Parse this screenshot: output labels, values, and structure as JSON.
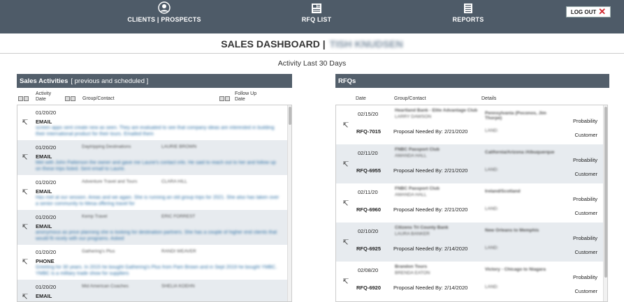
{
  "nav": {
    "clients_label": "CLIENTS | PROSPECTS",
    "rfq_label": "RFQ LIST",
    "reports_label": "REPORTS",
    "logout_label": "LOG OUT",
    "logout_icon": "x-icon"
  },
  "header": {
    "title": "SALES DASHBOARD |",
    "user_name": "TISH KNUDSEN"
  },
  "subtitle": "Activity Last 30 Days",
  "activities": {
    "title": "Sales Activities",
    "subtitle": "[ previous and scheduled ]",
    "col_activity_date": "Activity Date",
    "col_group": "Group/Contact",
    "col_followup": "Follow Up Date",
    "rows": [
      {
        "date": "01/20/20",
        "group": "",
        "contact": "",
        "type": "EMAIL",
        "note": "screen apps sent create new as seen. They are evaluated to see that company ideas are interested in building their international product for their tours. Emailed them"
      },
      {
        "date": "01/20/20",
        "group": "Daytripping Destinations",
        "contact": "LAURIE BROWN",
        "type": "EMAIL",
        "note": "Met with John Patterson the owner and gave me Laurie's contact info. He said to reach out to her and follow up on these trips listed. Sent email to Laurie."
      },
      {
        "date": "01/20/20",
        "group": "Adventure Travel and Tours",
        "contact": "CLARA HILL",
        "type": "EMAIL",
        "note": "Has met at our session. Areas and we again. She is running an old group trips for 2021. She also has taken over a senior community to Mesa offering travel for"
      },
      {
        "date": "01/20/20",
        "group": "Kemp Travel",
        "contact": "ERIC FORREST",
        "type": "EMAIL",
        "note": "anonymous as price planning she is looking for destination partners. She has a couple of higher end clients that would fit nicely with our programs. Asked"
      },
      {
        "date": "01/20/20",
        "group": "Gathering's Plus",
        "contact": "RANDI WEAVER",
        "type": "PHONE",
        "note": "Greeting for 30 years. In 2015 he bought Gathering's Plus from Pam Brown and in Sept 2019 he bought YMBC. YMBC is a military trade show for suppliers"
      },
      {
        "date": "01/20/20",
        "group": "Mid American Coaches",
        "contact": "SHELIA KOEHN",
        "type": "EMAIL",
        "note": ""
      }
    ]
  },
  "rfqs": {
    "title": "RFQs",
    "col_date": "Date",
    "col_group": "Group/Contact",
    "col_details": "Details",
    "probability_label": "Probability",
    "customer_label": "Customer",
    "rows": [
      {
        "date": "02/15/20",
        "number": "RFQ-7015",
        "needed": "Proposal Needed By: 2/21/2020",
        "group": "Heartland Bank - Elite Advantage Club",
        "contact": "LARRY DAWSON",
        "details": "Pennsylvania (Poconos, Jim Thorpe)",
        "land": "LAND:"
      },
      {
        "date": "02/11/20",
        "number": "RFQ-6955",
        "needed": "Proposal Needed By: 2/21/2020",
        "group": "FNBC Passport Club",
        "contact": "AMANDA HALL",
        "details": "California/Arizona /Albuquerque",
        "land": "LAND:"
      },
      {
        "date": "02/11/20",
        "number": "RFQ-6960",
        "needed": "Proposal Needed By: 2/21/2020",
        "group": "FNBC Passport Club",
        "contact": "AMANDA HALL",
        "details": "Ireland/Scotland",
        "land": "LAND:"
      },
      {
        "date": "02/10/20",
        "number": "RFQ-6925",
        "needed": "Proposal Needed By: 2/14/2020",
        "group": "Citizens Tri County Bank",
        "contact": "LAURA BANKER",
        "details": "New Orleans to Memphis",
        "land": "LAND:"
      },
      {
        "date": "02/08/20",
        "number": "RFQ-6920",
        "needed": "Proposal Needed By: 2/14/2020",
        "group": "Brandon Tours",
        "contact": "BRENDA EATON",
        "details": "Victory - Chicago to Niagara",
        "land": "LAND:"
      }
    ]
  }
}
